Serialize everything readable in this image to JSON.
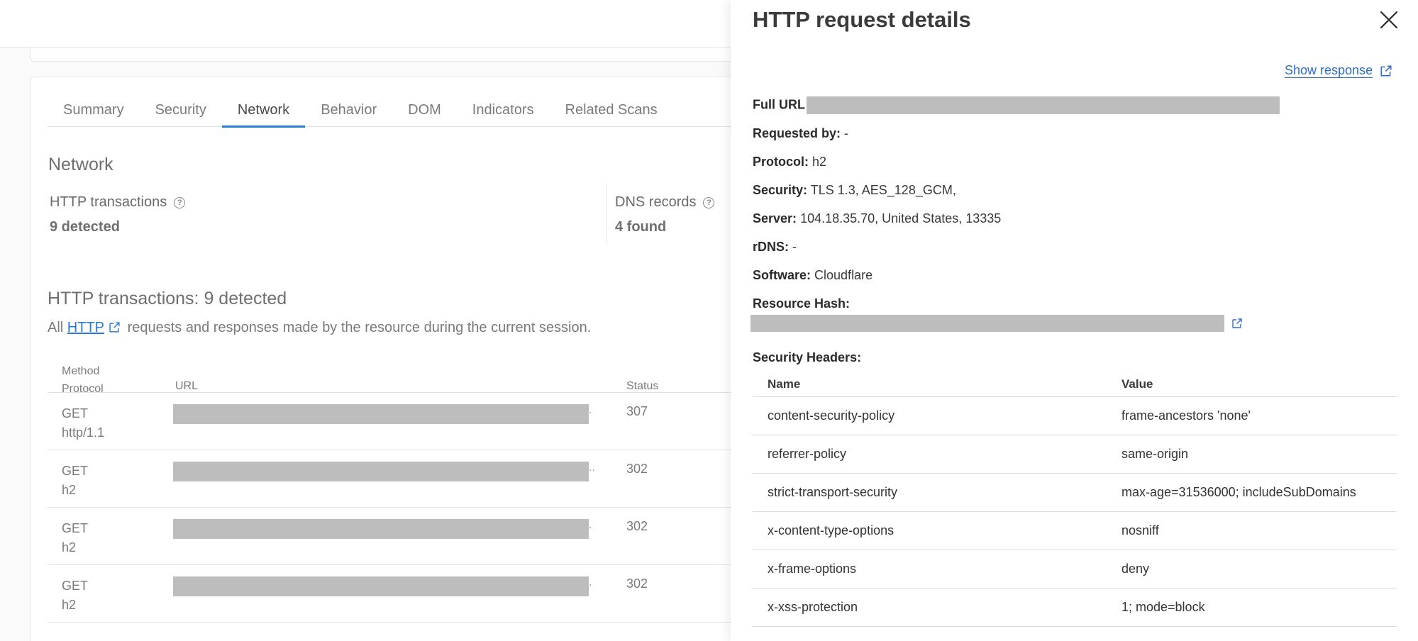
{
  "tabs": [
    "Summary",
    "Security",
    "Network",
    "Behavior",
    "DOM",
    "Indicators",
    "Related Scans"
  ],
  "active_tab": "Network",
  "network": {
    "title": "Network",
    "http_label": "HTTP transactions",
    "http_value": "9 detected",
    "dns_label": "DNS records",
    "dns_value": "4 found"
  },
  "transactions": {
    "title": "HTTP transactions: 9 detected",
    "desc_prefix": "All",
    "desc_link": "HTTP",
    "desc_suffix": "requests and responses made by the resource during the current session.",
    "headers": {
      "method": "Method",
      "protocol": "Protocol",
      "url": "URL",
      "status": "Status"
    },
    "rows": [
      {
        "method": "GET",
        "protocol": "http/1.1",
        "ellipsis": ".",
        "status": "307"
      },
      {
        "method": "GET",
        "protocol": "h2",
        "ellipsis": "..",
        "status": "302"
      },
      {
        "method": "GET",
        "protocol": "h2",
        "ellipsis": ".",
        "status": "302"
      },
      {
        "method": "GET",
        "protocol": "h2",
        "ellipsis": ".",
        "status": "302"
      }
    ]
  },
  "drawer": {
    "title": "HTTP request details",
    "show_response": "Show response",
    "full_url_label": "Full URL",
    "requested_by_label": "Requested by:",
    "requested_by": "-",
    "protocol_label": "Protocol:",
    "protocol": "h2",
    "security_label": "Security:",
    "security": "TLS 1.3, AES_128_GCM,",
    "server_label": "Server:",
    "server": "104.18.35.70, United States, 13335",
    "rdns_label": "rDNS:",
    "rdns": "-",
    "software_label": "Software:",
    "software": "Cloudflare",
    "resource_hash_label": "Resource Hash:",
    "security_headers_label": "Security Headers:",
    "sec_headers_cols": {
      "name": "Name",
      "value": "Value"
    },
    "security_headers": [
      {
        "name": "content-security-policy",
        "value": "frame-ancestors 'none'"
      },
      {
        "name": "referrer-policy",
        "value": "same-origin"
      },
      {
        "name": "strict-transport-security",
        "value": "max-age=31536000; includeSubDomains"
      },
      {
        "name": "x-content-type-options",
        "value": "nosniff"
      },
      {
        "name": "x-frame-options",
        "value": "deny"
      },
      {
        "name": "x-xss-protection",
        "value": "1; mode=block"
      }
    ]
  },
  "colors": {
    "accent": "#2b7bd8",
    "link": "#2b6fc9",
    "redaction": "#bdbdbd"
  },
  "icons": [
    "help-icon",
    "external-link-icon",
    "close-icon"
  ]
}
